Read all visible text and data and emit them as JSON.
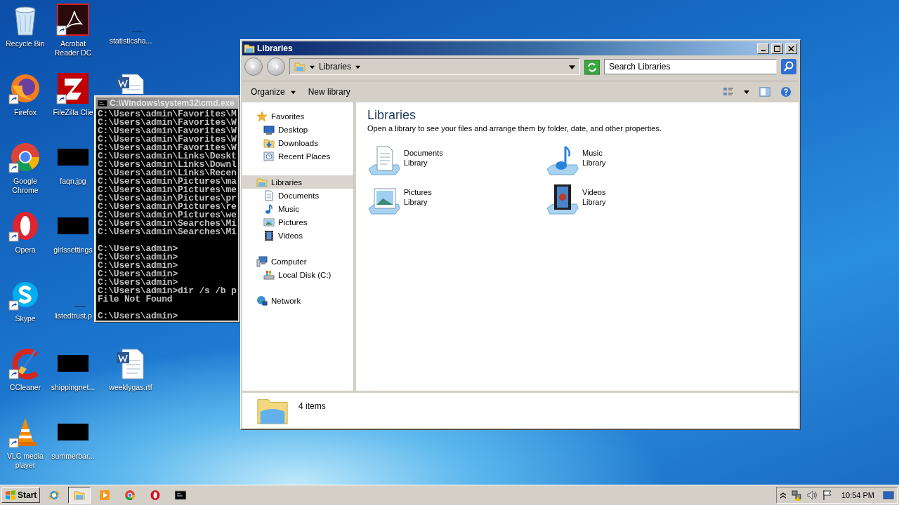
{
  "desktop": {
    "columns": [
      [
        {
          "label": "Recycle Bin",
          "kind": "recycle",
          "shortcut": false
        },
        {
          "label": "Firefox",
          "kind": "firefox",
          "shortcut": true
        },
        {
          "label": "Google Chrome",
          "kind": "chrome",
          "shortcut": true
        },
        {
          "label": "Opera",
          "kind": "opera",
          "shortcut": true
        },
        {
          "label": "Skype",
          "kind": "skype",
          "shortcut": true
        },
        {
          "label": "CCleaner",
          "kind": "ccleaner",
          "shortcut": true
        },
        {
          "label": "VLC media player",
          "kind": "vlc",
          "shortcut": true
        }
      ],
      [
        {
          "label": "Acrobat Reader DC",
          "kind": "acrobat",
          "shortcut": true
        },
        {
          "label": "FileZilla Clie",
          "kind": "filezilla",
          "shortcut": true
        },
        {
          "label": "faqn.jpg",
          "kind": "thumbnail",
          "shortcut": false
        },
        {
          "label": "girlssettings",
          "kind": "thumbnail",
          "shortcut": false
        },
        {
          "label": "listedtrust.p",
          "kind": "blank"
        },
        {
          "label": "shippingnet...",
          "kind": "thumbnail",
          "shortcut": false
        },
        {
          "label": "summerbar...",
          "kind": "thumbnail",
          "shortcut": false
        }
      ],
      [
        {
          "label": "statisticsha...",
          "kind": "blank"
        },
        {
          "kind": "word"
        },
        null,
        null,
        null,
        {
          "label": "weeklygas.rtf",
          "kind": "word",
          "shortcut": false
        },
        null
      ]
    ]
  },
  "cmd_window": {
    "title": "C:\\Windows\\system32\\cmd.exe",
    "blocks": [
      [
        "C:\\Users\\admin\\Favorites\\M",
        "C:\\Users\\admin\\Favorites\\W",
        "C:\\Users\\admin\\Favorites\\W",
        "C:\\Users\\admin\\Favorites\\W",
        "C:\\Users\\admin\\Favorites\\W",
        "C:\\Users\\admin\\Links\\Deskt",
        "C:\\Users\\admin\\Links\\Downl",
        "C:\\Users\\admin\\Links\\Recen",
        "C:\\Users\\admin\\Pictures\\ma",
        "C:\\Users\\admin\\Pictures\\me",
        "C:\\Users\\admin\\Pictures\\pr",
        "C:\\Users\\admin\\Pictures\\re",
        "C:\\Users\\admin\\Pictures\\we",
        "C:\\Users\\admin\\Searches\\Mi",
        "C:\\Users\\admin\\Searches\\Mi"
      ],
      [
        "C:\\Users\\admin>",
        "C:\\Users\\admin>",
        "C:\\Users\\admin>",
        "C:\\Users\\admin>",
        "C:\\Users\\admin>",
        "C:\\Users\\admin>dir /s /b p",
        "File Not Found"
      ],
      [
        "C:\\Users\\admin>"
      ]
    ]
  },
  "explorer": {
    "title": "Libraries",
    "address": "Libraries",
    "search": {
      "placeholder": "Search Libraries"
    },
    "commands": [
      {
        "label": "Organize",
        "kind": "menu"
      },
      {
        "label": "New library",
        "kind": "button"
      }
    ],
    "nav": [
      {
        "label": "Favorites",
        "kind": "star",
        "selected": false,
        "children": [
          {
            "label": "Desktop",
            "kind": "desktop",
            "selected": false
          },
          {
            "label": "Downloads",
            "kind": "downloads",
            "selected": false
          },
          {
            "label": "Recent Places",
            "kind": "recent",
            "selected": false
          }
        ]
      },
      {
        "label": "Libraries",
        "kind": "library",
        "selected": true,
        "children": [
          {
            "label": "Documents",
            "kind": "documents",
            "selected": false
          },
          {
            "label": "Music",
            "kind": "music",
            "selected": false
          },
          {
            "label": "Pictures",
            "kind": "pictures",
            "selected": false
          },
          {
            "label": "Videos",
            "kind": "videos",
            "selected": false
          }
        ]
      },
      {
        "label": "Computer",
        "kind": "computer",
        "selected": false,
        "children": [
          {
            "label": "Local Disk (C:)",
            "kind": "disk",
            "selected": false
          }
        ]
      },
      {
        "label": "Network",
        "kind": "network",
        "selected": false
      }
    ],
    "heading": "Libraries",
    "description": "Open a library to see your files and arrange them by folder, date, and other properties.",
    "libraries": [
      {
        "name": "Documents",
        "type": "Library",
        "kind": "documents"
      },
      {
        "name": "Music",
        "type": "Library",
        "kind": "music"
      },
      {
        "name": "Pictures",
        "type": "Library",
        "kind": "pictures"
      },
      {
        "name": "Videos",
        "type": "Library",
        "kind": "videos"
      }
    ],
    "status": "4 items"
  },
  "taskbar": {
    "start": "Start",
    "buttons": [
      {
        "kind": "ie",
        "selected": false
      },
      {
        "kind": "explorer",
        "selected": true
      },
      {
        "kind": "media",
        "selected": false
      },
      {
        "kind": "chrome",
        "selected": false
      },
      {
        "kind": "opera",
        "selected": false
      },
      {
        "kind": "cmd",
        "selected": false
      }
    ],
    "time": "10:54 PM"
  }
}
